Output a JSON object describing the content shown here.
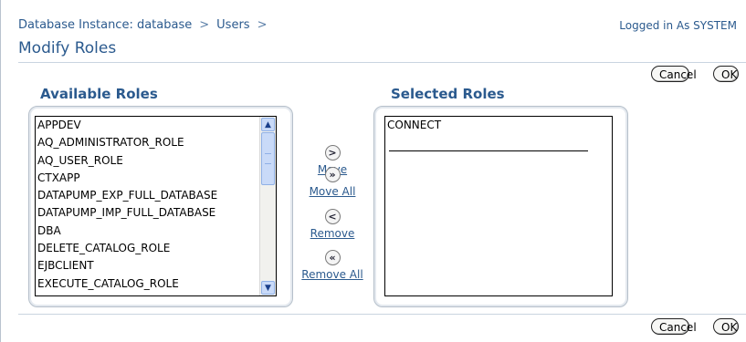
{
  "breadcrumb": {
    "items": [
      {
        "label": "Database Instance: database"
      },
      {
        "label": "Users"
      }
    ],
    "separator": ">"
  },
  "header": {
    "login_info": "Logged in As SYSTEM",
    "title": "Modify Roles"
  },
  "buttons": {
    "cancel": "Cancel",
    "ok": "OK"
  },
  "available": {
    "title": "Available Roles",
    "items": [
      "APPDEV",
      "AQ_ADMINISTRATOR_ROLE",
      "AQ_USER_ROLE",
      "CTXAPP",
      "DATAPUMP_EXP_FULL_DATABASE",
      "DATAPUMP_IMP_FULL_DATABASE",
      "DBA",
      "DELETE_CATALOG_ROLE",
      "EJBCLIENT",
      "EXECUTE_CATALOG_ROLE"
    ]
  },
  "selected": {
    "title": "Selected Roles",
    "items": [
      "CONNECT"
    ]
  },
  "shuttle": {
    "move": "Move",
    "move_all": "Move All",
    "remove": "Remove",
    "remove_all": "Remove All",
    "move_glyph": ">",
    "move_all_glyph": "»",
    "remove_glyph": "<",
    "remove_all_glyph": "«"
  },
  "icons": {
    "scroll_up": "▲",
    "scroll_down": "▼"
  },
  "colors": {
    "accent": "#2b5a8e",
    "scrollbar": "#c9daf8"
  }
}
